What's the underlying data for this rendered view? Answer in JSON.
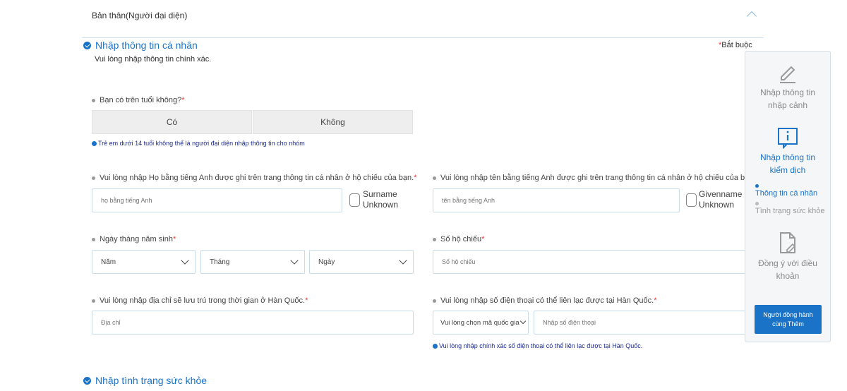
{
  "accordion": {
    "title": "Bản thân(Người đại diện)"
  },
  "personal_section": {
    "title": "Nhập thông tin cá nhân",
    "required_note": "Bắt buộc",
    "subtitle": "Vui lòng nhập thông tin chính xác."
  },
  "age_question": {
    "label": "Bạn có trên tuổi không?",
    "yes_label": "Có",
    "no_label": "Không",
    "note": "Trẻ em dưới 14 tuổi không thể là người đại diện nhập thông tin cho nhóm"
  },
  "surname": {
    "label": "Vui lòng nhập Họ bằng tiếng Anh được ghi trên trang thông tin cá nhân ở hộ chiếu của bạn.",
    "placeholder": "họ bằng tiếng Anh",
    "unknown_label_1": "Surname",
    "unknown_label_2": "Unknown"
  },
  "givenname": {
    "label": "Vui lòng nhập tên bằng tiếng Anh được ghi trên trang thông tin cá nhân ở hộ chiếu của bạn.",
    "placeholder": "tên bằng tiếng Anh",
    "unknown_label_1": "Givenname",
    "unknown_label_2": "Unknown"
  },
  "birthdate": {
    "label": "Ngày tháng năm sinh",
    "year": "Năm",
    "month": "Tháng",
    "day": "Ngày"
  },
  "passport": {
    "label": "Số hộ chiếu",
    "placeholder": "Số hộ chiếu"
  },
  "address": {
    "label": "Vui lòng nhập địa chỉ sẽ lưu trú trong thời gian ở Hàn Quốc.",
    "placeholder": "Địa chỉ"
  },
  "phone": {
    "label": "Vui lòng nhập số điện thoại có thể liên lạc được tại Hàn Quốc.",
    "country_code": "Vui lòng chọn mã quốc gia",
    "placeholder": "Nhập số điện thoại",
    "note": "Vui lòng nhập chính xác số điện thoại có thể liên lạc được tại Hàn Quốc."
  },
  "health_section": {
    "title": "Nhập tình trạng sức khỏe"
  },
  "side_panel": {
    "step1_line1": "Nhập thông tin",
    "step1_line2": "nhập cảnh",
    "step2_line1": "Nhập thông tin",
    "step2_line2": "kiểm dịch",
    "sub1": "Thông tin cá nhân",
    "sub2": "Tình trạng sức khỏe",
    "step3_line1": "Đồng ý với điều",
    "step3_line2": "khoản",
    "companion_line1": "Người đồng hành",
    "companion_line2": "cùng Thêm"
  },
  "colors": {
    "accent": "#1b73c7",
    "required": "#e53935",
    "note_text": "#1b2a8c"
  }
}
